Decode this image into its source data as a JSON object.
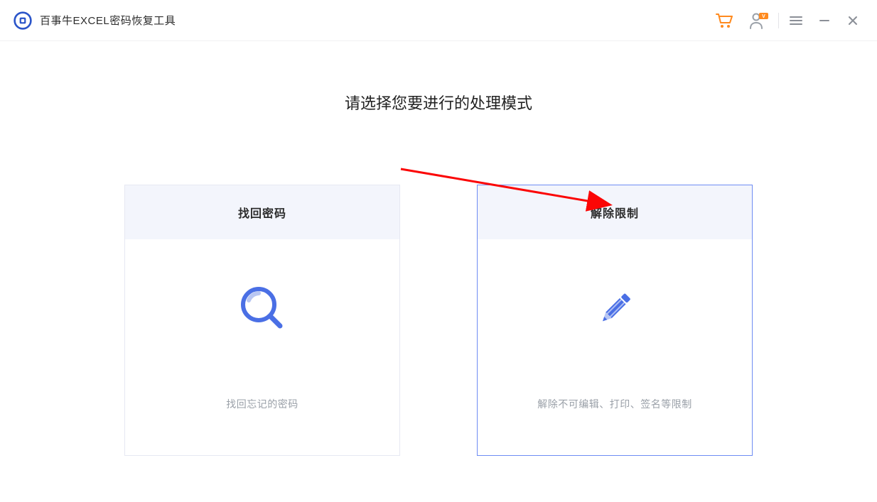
{
  "app": {
    "title": "百事牛EXCEL密码恢复工具"
  },
  "titlebar": {
    "cart_icon": "cart",
    "user_icon": "user-vip",
    "menu_icon": "menu",
    "minimize_icon": "minimize",
    "close_icon": "close"
  },
  "main": {
    "heading": "请选择您要进行的处理模式",
    "cards": [
      {
        "title": "找回密码",
        "desc": "找回忘记的密码",
        "icon": "magnifier",
        "selected": false
      },
      {
        "title": "解除限制",
        "desc": "解除不可编辑、打印、签名等限制",
        "icon": "pencil",
        "selected": true
      }
    ]
  }
}
